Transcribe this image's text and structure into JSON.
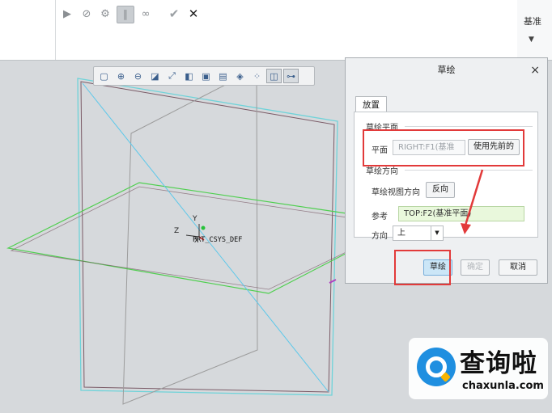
{
  "ribbon": {
    "icons": [
      {
        "name": "play-icon",
        "glyph": "▶"
      },
      {
        "name": "no-entry-icon",
        "glyph": "⊘"
      },
      {
        "name": "sketch-tool-icon",
        "glyph": "⚙"
      },
      {
        "name": "sketch-mode-icon",
        "glyph": "∥"
      },
      {
        "name": "glasses-icon",
        "glyph": "∞"
      },
      {
        "name": "check-icon",
        "glyph": "✔"
      },
      {
        "name": "close-icon",
        "glyph": "✕"
      }
    ],
    "datum_label": "基准"
  },
  "viewport": {
    "csys_label": "PRT_CSYS_DEF",
    "axis_x": "X",
    "axis_y": "Y",
    "axis_z": "Z"
  },
  "view_toolbar": {
    "icons": [
      "refit-icon",
      "zoom-in-icon",
      "zoom-out-icon",
      "repaint-icon",
      "spin-center-icon",
      "display-style-icon",
      "saved-views-icon",
      "view-manager-icon",
      "perspective-icon",
      "datum-display-icon",
      "annotation-icon",
      "sketch-view-icon"
    ]
  },
  "dialog": {
    "title": "草绘",
    "close_glyph": "×",
    "tab_label": "放置",
    "sketch_plane_section": "草绘平面",
    "plane_label": "平面",
    "plane_value": "RIGHT:F1(基准",
    "use_previous_button": "使用先前的",
    "orientation_section": "草绘方向",
    "view_dir_label": "草绘视图方向",
    "flip_button": "反向",
    "reference_label": "参考",
    "reference_value": "TOP:F2(基准平面)",
    "direction_label": "方向",
    "direction_value": "上",
    "sketch_button": "草绘",
    "ok_button": "确定",
    "cancel_button": "取消"
  },
  "watermark": {
    "brand_cn": "查询啦",
    "brand_en": "chaxunla.com"
  },
  "colors": {
    "highlight": "#e23a3a",
    "plane_right": "#6fd3d9",
    "plane_top": "#4fcf4f",
    "plane_front": "#9c9c9c",
    "diagonal": "#5cc8ea"
  }
}
